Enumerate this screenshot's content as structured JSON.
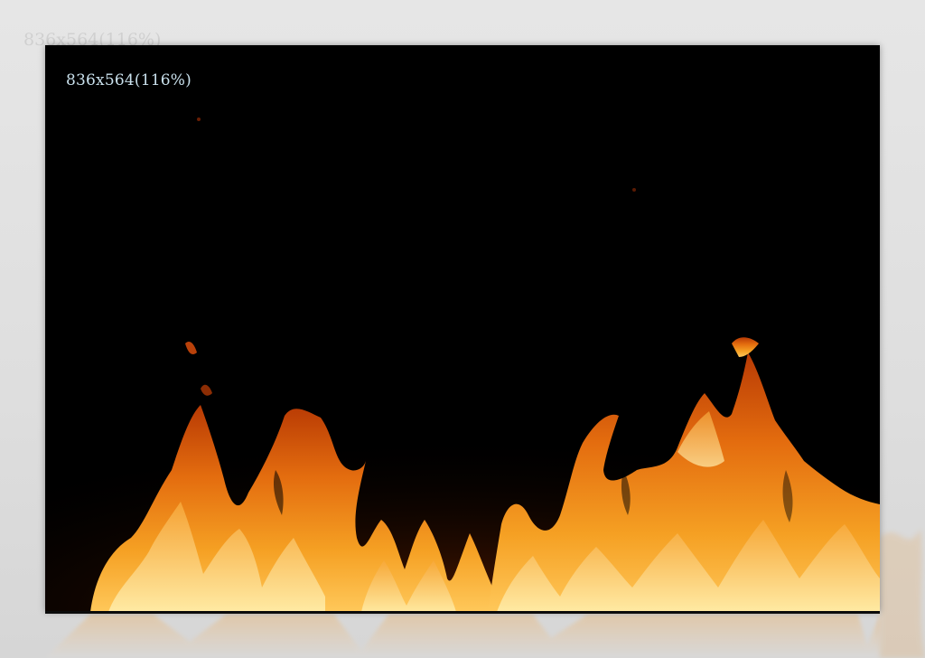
{
  "viewer": {
    "size_label": "836x564(116%)"
  },
  "background": {
    "caption": "836x564(116%)"
  },
  "image": {
    "subject_icon": "flame-image",
    "colors": {
      "background": "#000000",
      "flame_outer": "#d14a06",
      "flame_mid": "#f39a1c",
      "flame_core": "#ffe27a"
    }
  }
}
